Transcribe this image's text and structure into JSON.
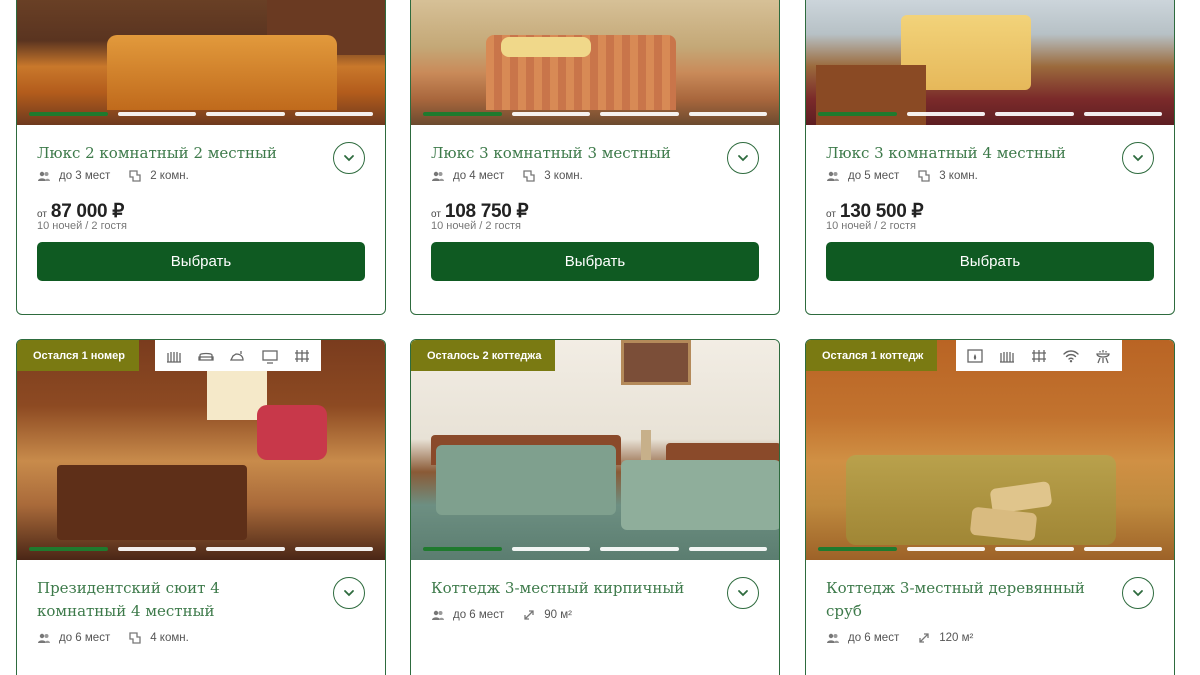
{
  "rooms": [
    {
      "title": "Люкс 2 комнатный 2 местный",
      "guests": "до 3 мест",
      "rooms_or_area": "2 комн.",
      "price_from": "от",
      "price": "87 000 ₽",
      "nights_note": "10 ночей / 2 гостя",
      "button": "Выбрать"
    },
    {
      "title": "Люкс 3 комнатный 3 местный",
      "guests": "до 4 мест",
      "rooms_or_area": "3 комн.",
      "price_from": "от",
      "price": "108 750 ₽",
      "nights_note": "10 ночей / 2 гостя",
      "button": "Выбрать"
    },
    {
      "title": "Люкс 3 комнатный 4 местный",
      "guests": "до 5 мест",
      "rooms_or_area": "3 комн.",
      "price_from": "от",
      "price": "130 500 ₽",
      "nights_note": "10 ночей / 2 гостя",
      "button": "Выбрать"
    },
    {
      "badge": "Остался 1 номер",
      "title": "Президентский сюит 4 комнатный 4 местный",
      "guests": "до 6 мест",
      "rooms_or_area": "4 комн.",
      "amenities": [
        "heater-icon",
        "sofa-icon",
        "iron-icon",
        "tv-icon",
        "radiator-icon"
      ]
    },
    {
      "badge": "Осталось 2 коттеджа",
      "title": "Коттедж 3-местный кирпичный",
      "guests": "до 6 мест",
      "rooms_or_area": "90 м²"
    },
    {
      "badge": "Остался 1 коттедж",
      "title": "Коттедж 3-местный деревянный сруб",
      "guests": "до 6 мест",
      "rooms_or_area": "120 м²",
      "amenities": [
        "fireplace-icon",
        "heater-icon",
        "radiator-icon",
        "wifi-icon",
        "grill-icon"
      ]
    }
  ],
  "colors": {
    "accent": "#0f5a22",
    "title_green": "#3d7a4a",
    "badge": "#7a7a12",
    "border": "#2e6b3e"
  }
}
